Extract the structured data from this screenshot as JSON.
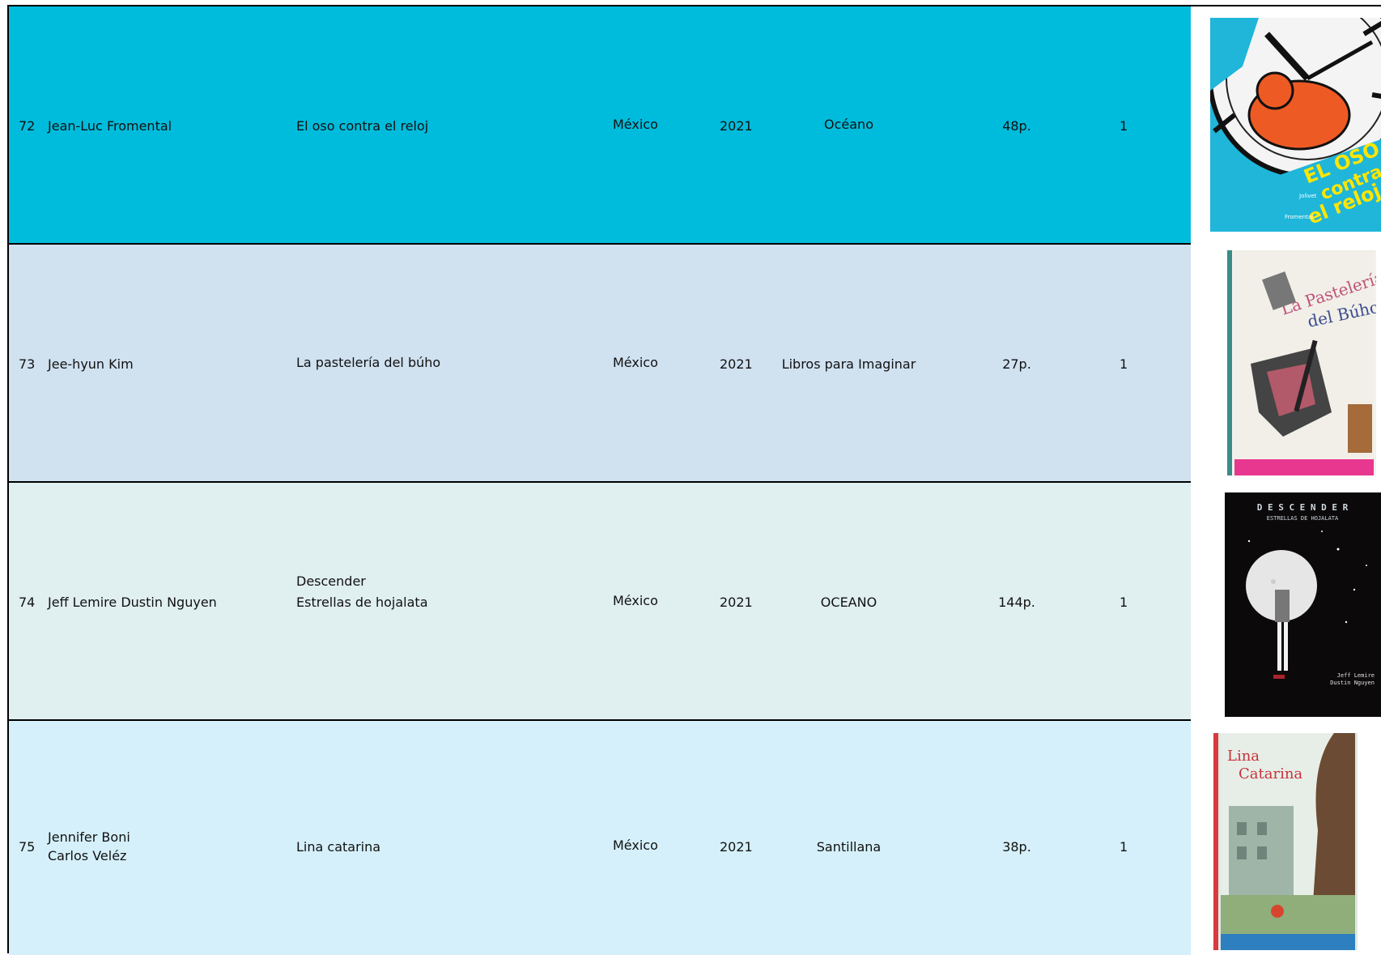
{
  "rows": [
    {
      "num": "72",
      "author": "Jean-Luc  Fromental",
      "title": "El oso contra el reloj",
      "country": "México",
      "year": "2021",
      "publisher": "Océano",
      "pages": "48p.",
      "copies": "1",
      "bg": "#00bcdc",
      "cover": {
        "title_lines": [
          "EL OSO",
          "contra",
          "el reloj"
        ],
        "authors": [
          "Jolivet",
          "Fromental"
        ]
      }
    },
    {
      "num": "73",
      "author": "Jee-hyun Kim",
      "title": "La pastelería del búho",
      "country": "México",
      "year": "2021",
      "publisher": "Libros para Imaginar",
      "pages": "27p.",
      "copies": "1",
      "bg": "#d0e1f0",
      "cover": {
        "title_lines": [
          "La Pastelería",
          "del Búho"
        ]
      }
    },
    {
      "num": "74",
      "author": "Jeff Lemire Dustin Nguyen",
      "title_lines": [
        "Descender",
        "Estrellas de hojalata"
      ],
      "country": "México",
      "year": "2021",
      "publisher": "OCEANO",
      "pages": "144p.",
      "copies": "1",
      "bg": "#e0eff0",
      "cover": {
        "title_lines": [
          "D E S C E N D E R",
          "ESTRELLAS DE HOJALATA"
        ],
        "authors": [
          "Jeff Lemire",
          "Dustin Nguyen"
        ]
      }
    },
    {
      "num": "75",
      "author_lines": [
        "Jennifer Boni",
        "Carlos Veléz"
      ],
      "title": "Lina catarina",
      "country": "México",
      "year": "2021",
      "publisher": "Santillana",
      "pages": "38p.",
      "copies": "1",
      "bg": "#d5f0fa",
      "cover": {
        "title_lines": [
          "Lina",
          "Catarina"
        ]
      }
    }
  ]
}
